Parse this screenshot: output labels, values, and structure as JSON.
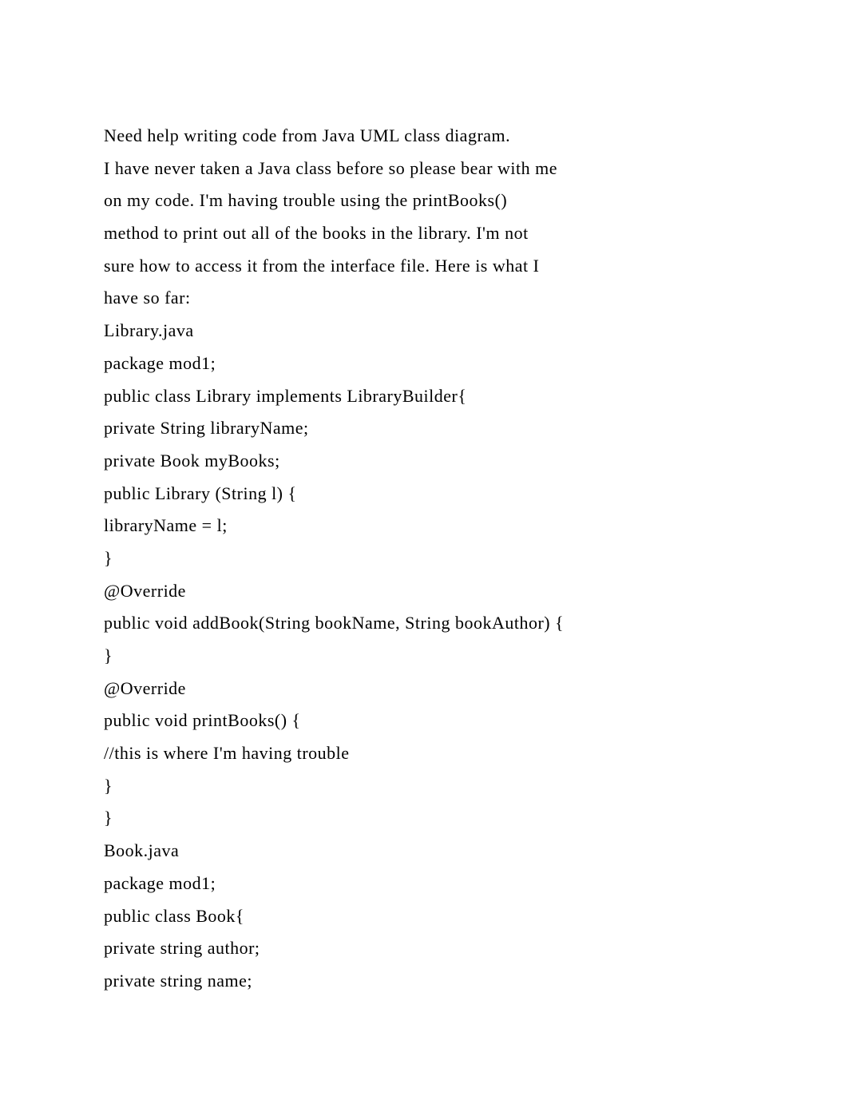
{
  "lines": [
    "Need help writing code from Java UML class diagram.",
    "I have never taken a Java class before so please bear with me",
    "on my code. I'm having trouble using the printBooks()",
    "method to print out all of the books in the library. I'm not",
    "sure how to access it from the interface file. Here is what I",
    "have so far:",
    "Library.java",
    "package mod1;",
    "public class Library implements LibraryBuilder{",
    "private String libraryName;",
    "private Book myBooks;",
    "public Library (String l) {",
    "libraryName = l;",
    "}",
    "@Override",
    "public void addBook(String bookName, String bookAuthor) {",
    "}",
    "@Override",
    "public void printBooks() {",
    "//this is where I'm having trouble",
    "}",
    "}",
    "Book.java",
    "package mod1;",
    "public class Book{",
    "private string author;",
    "private string name;"
  ]
}
